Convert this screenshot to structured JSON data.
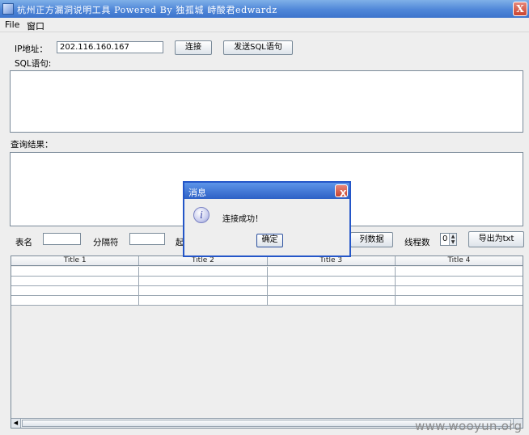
{
  "window": {
    "title": "杭州正方漏洞说明工具 Powered By 独孤城 峙酸君edwardz",
    "close_label": "X"
  },
  "menu": {
    "items": [
      "File",
      "窗口"
    ]
  },
  "connection": {
    "ip_label": "IP地址：",
    "ip_value": "202.116.160.167",
    "connect_label": "连接",
    "send_sql_label": "发送SQL语句"
  },
  "sql": {
    "label": "SQL语句:"
  },
  "results": {
    "label": "查询结果："
  },
  "options": {
    "table_label": "表名",
    "separator_label": "分隔符",
    "start_label_partial": "起",
    "list_data_label": "列数据",
    "threads_label": "线程数",
    "threads_value": "0",
    "export_label": "导出为txt"
  },
  "table": {
    "headers": [
      "Title 1",
      "Title 2",
      "Title 3",
      "Title 4"
    ]
  },
  "dialog": {
    "title": "消息",
    "message": "连接成功！",
    "ok_label": "确定",
    "icon_letter": "i",
    "close_label": "X"
  },
  "watermark": {
    "text": "www.wooyun.org"
  },
  "icons": {
    "window_close": "close-icon",
    "dialog_info": "info-icon"
  }
}
